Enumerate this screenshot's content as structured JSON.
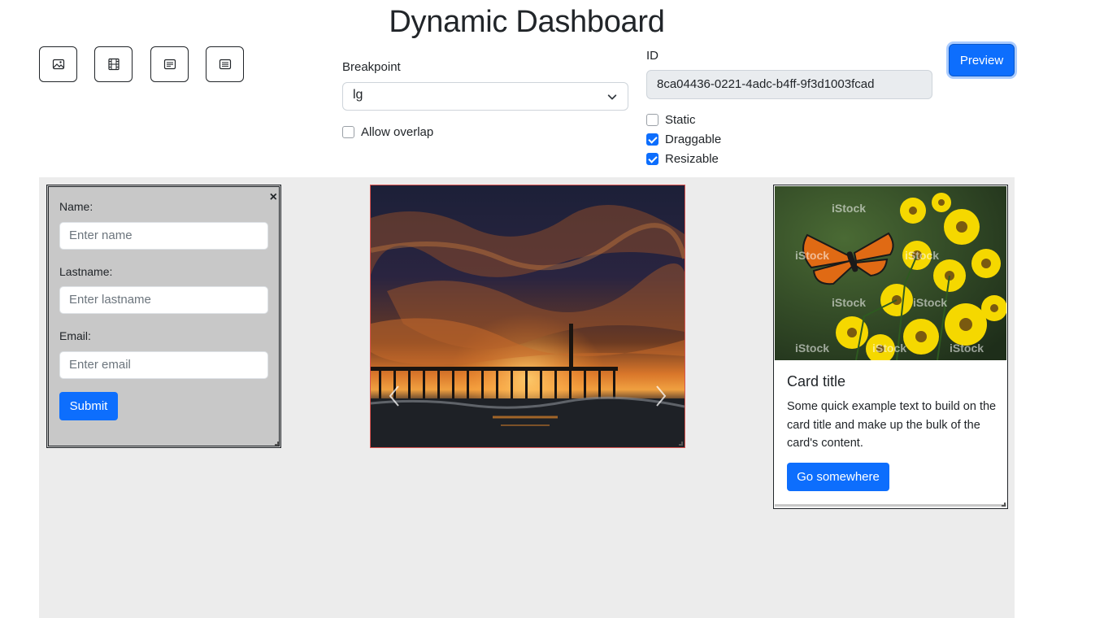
{
  "header": {
    "title": "Dynamic Dashboard"
  },
  "toolbar": {
    "tools": [
      {
        "name": "image-widget-icon"
      },
      {
        "name": "video-widget-icon"
      },
      {
        "name": "card-widget-icon"
      },
      {
        "name": "form-widget-icon"
      }
    ],
    "preview_label": "Preview"
  },
  "settings": {
    "breakpoint_label": "Breakpoint",
    "breakpoint_value": "lg",
    "allow_overlap_label": "Allow overlap",
    "allow_overlap": false,
    "id_label": "ID",
    "id_value": "8ca04436-0221-4adc-b4ff-9f3d1003fcad",
    "static_label": "Static",
    "static": false,
    "draggable_label": "Draggable",
    "draggable": true,
    "resizable_label": "Resizable",
    "resizable": true
  },
  "form_widget": {
    "close_label": "×",
    "name_label": "Name:",
    "name_placeholder": "Enter name",
    "lastname_label": "Lastname:",
    "lastname_placeholder": "Enter lastname",
    "email_label": "Email:",
    "email_placeholder": "Enter email",
    "submit_label": "Submit"
  },
  "card_widget": {
    "title": "Card title",
    "text": "Some quick example text to build on the card title and make up the bulk of the card's content.",
    "button_label": "Go somewhere",
    "watermark": "iStock"
  },
  "colors": {
    "primary": "#0d6efd",
    "canvas": "#ececec",
    "form_bg": "#c8c8c8",
    "carousel_border": "#d9534f"
  }
}
